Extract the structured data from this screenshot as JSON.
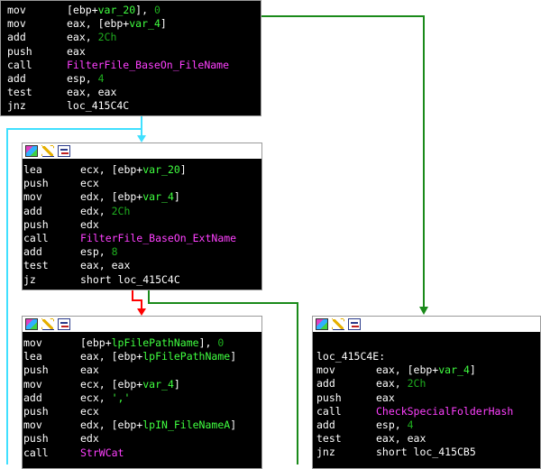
{
  "colors": {
    "background": "#ffffff",
    "block_bg": "#000000",
    "text": "#ffffff",
    "variable": "#40ff40",
    "number": "#1faf1f",
    "function": "#ff40ff",
    "label": "#ffff00",
    "edge_true": "#40e0ff",
    "edge_false_red": "#ff0000",
    "edge_green": "#1a8a1a",
    "edge_cyan": "#40e0ff"
  },
  "header_icons": [
    "graph-icon",
    "edit-icon",
    "xrefs-icon"
  ],
  "blocks": {
    "top": {
      "lines": [
        {
          "mn": "mov",
          "ops": "[ebp+var_20], 0"
        },
        {
          "mn": "mov",
          "ops": "eax, [ebp+var_4]"
        },
        {
          "mn": "add",
          "ops": "eax, 2Ch"
        },
        {
          "mn": "push",
          "ops": "eax"
        },
        {
          "mn": "call",
          "ops": "FilterFile_BaseOn_FileName"
        },
        {
          "mn": "add",
          "ops": "esp, 4"
        },
        {
          "mn": "test",
          "ops": "eax, eax"
        },
        {
          "mn": "jnz",
          "ops": "loc_415C4C"
        }
      ]
    },
    "middle": {
      "lines": [
        {
          "mn": "lea",
          "ops": "ecx, [ebp+var_20]"
        },
        {
          "mn": "push",
          "ops": "ecx"
        },
        {
          "mn": "mov",
          "ops": "edx, [ebp+var_4]"
        },
        {
          "mn": "add",
          "ops": "edx, 2Ch"
        },
        {
          "mn": "push",
          "ops": "edx"
        },
        {
          "mn": "call",
          "ops": "FilterFile_BaseOn_ExtName"
        },
        {
          "mn": "add",
          "ops": "esp, 8"
        },
        {
          "mn": "test",
          "ops": "eax, eax"
        },
        {
          "mn": "jz",
          "ops": "short loc_415C4C"
        }
      ]
    },
    "bottom_left": {
      "lines": [
        {
          "mn": "mov",
          "ops": "[ebp+lpFilePathName], 0"
        },
        {
          "mn": "lea",
          "ops": "eax, [ebp+lpFilePathName]"
        },
        {
          "mn": "push",
          "ops": "eax"
        },
        {
          "mn": "mov",
          "ops": "ecx, [ebp+var_4]"
        },
        {
          "mn": "add",
          "ops": "ecx, ','"
        },
        {
          "mn": "push",
          "ops": "ecx"
        },
        {
          "mn": "mov",
          "ops": "edx, [ebp+lpIN_FileNameA]"
        },
        {
          "mn": "push",
          "ops": "edx"
        },
        {
          "mn": "call",
          "ops": "StrWCat"
        }
      ]
    },
    "bottom_right": {
      "label": "loc_415C4E:",
      "lines": [
        {
          "mn": "mov",
          "ops": "eax, [ebp+var_4]"
        },
        {
          "mn": "add",
          "ops": "eax, 2Ch"
        },
        {
          "mn": "push",
          "ops": "eax"
        },
        {
          "mn": "call",
          "ops": "CheckSpecialFolderHash"
        },
        {
          "mn": "add",
          "ops": "esp, 4"
        },
        {
          "mn": "test",
          "ops": "eax, eax"
        },
        {
          "mn": "jnz",
          "ops": "short loc_415CB5"
        }
      ]
    }
  }
}
